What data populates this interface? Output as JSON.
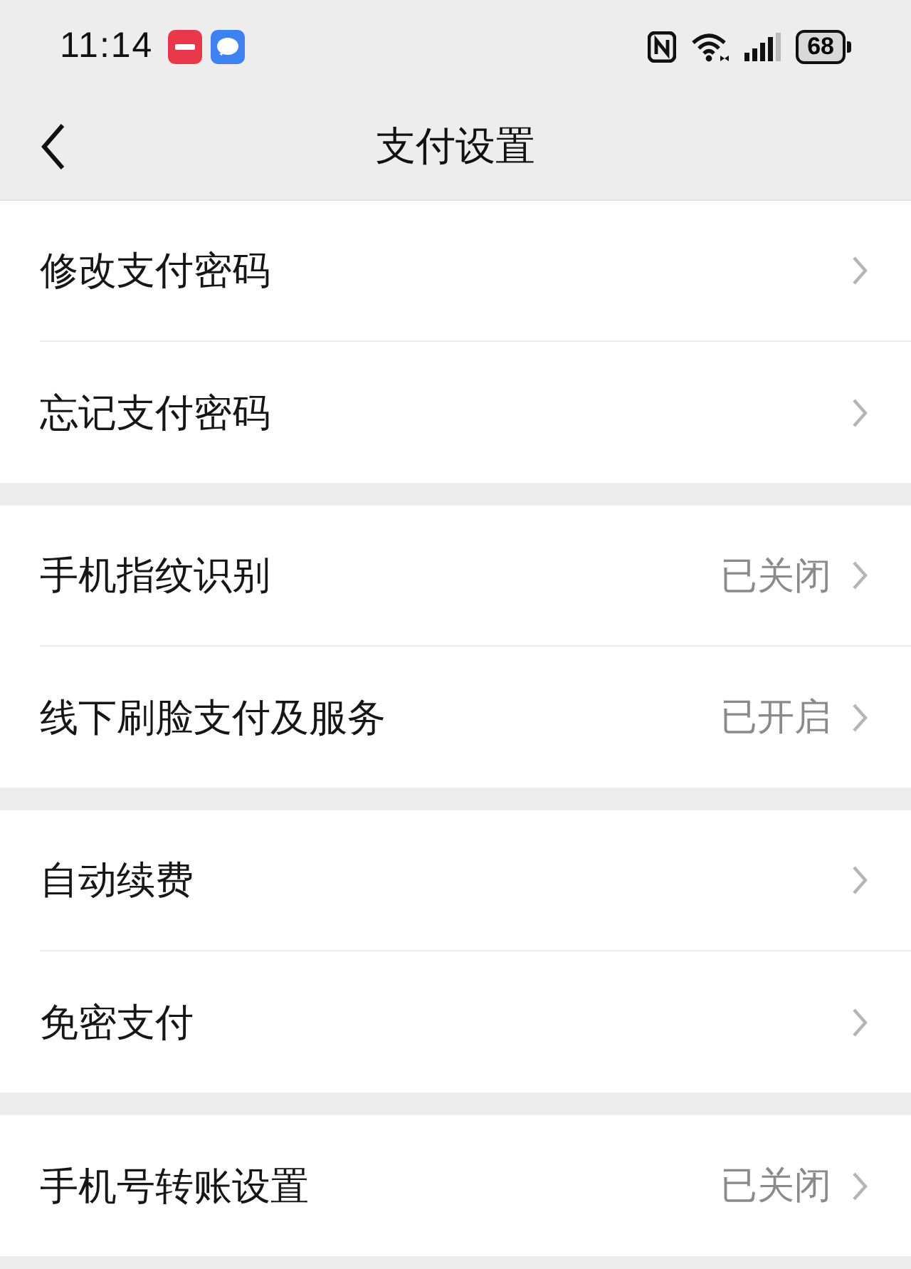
{
  "status_bar": {
    "time": "11:14",
    "battery": "68"
  },
  "header": {
    "title": "支付设置"
  },
  "groups": [
    {
      "items": [
        {
          "label": "修改支付密码"
        },
        {
          "label": "忘记支付密码"
        }
      ]
    },
    {
      "items": [
        {
          "label": "手机指纹识别",
          "value": "已关闭"
        },
        {
          "label": "线下刷脸支付及服务",
          "value": "已开启"
        }
      ]
    },
    {
      "items": [
        {
          "label": "自动续费"
        },
        {
          "label": "免密支付"
        }
      ]
    },
    {
      "items": [
        {
          "label": "手机号转账设置",
          "value": "已关闭"
        }
      ]
    }
  ]
}
